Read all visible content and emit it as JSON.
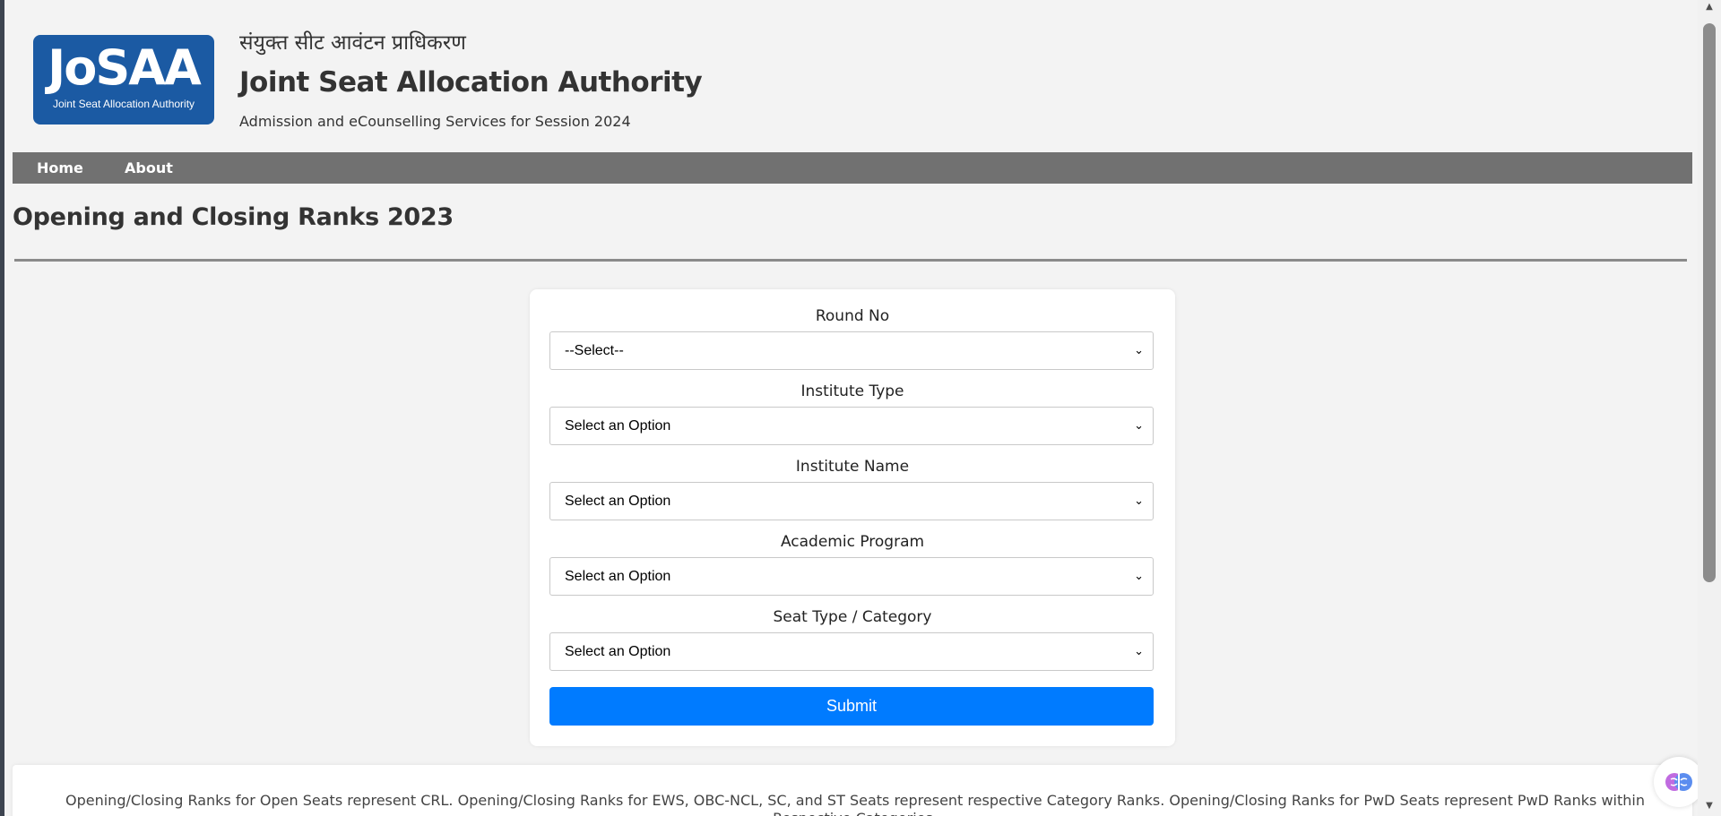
{
  "header": {
    "logo_text": "JoSAA",
    "logo_subtitle": "Joint Seat Allocation Authority",
    "hindi_title": "संयुक्त सीट आवंटन प्राधिकरण",
    "title": "Joint Seat Allocation Authority",
    "subtitle": "Admission and eCounselling Services for Session 2024",
    "brand_color": "#1b5aa3"
  },
  "nav": {
    "items": [
      {
        "label": "Home"
      },
      {
        "label": "About"
      }
    ],
    "background": "#717171"
  },
  "page": {
    "heading": "Opening and Closing Ranks 2023"
  },
  "form": {
    "fields": [
      {
        "label": "Round No",
        "value": "--Select--"
      },
      {
        "label": "Institute Type",
        "value": "Select an Option"
      },
      {
        "label": "Institute Name",
        "value": "Select an Option"
      },
      {
        "label": "Academic Program",
        "value": "Select an Option"
      },
      {
        "label": "Seat Type / Category",
        "value": "Select an Option"
      }
    ],
    "submit_label": "Submit",
    "submit_color": "#007bff"
  },
  "note": {
    "text": "Opening/Closing Ranks for Open Seats represent CRL. Opening/Closing Ranks for EWS, OBC-NCL, SC, and ST Seats represent respective Category Ranks. Opening/Closing Ranks for PwD Seats represent PwD Ranks within Respective Categories."
  },
  "assistant": {
    "icon": "brain-icon"
  }
}
